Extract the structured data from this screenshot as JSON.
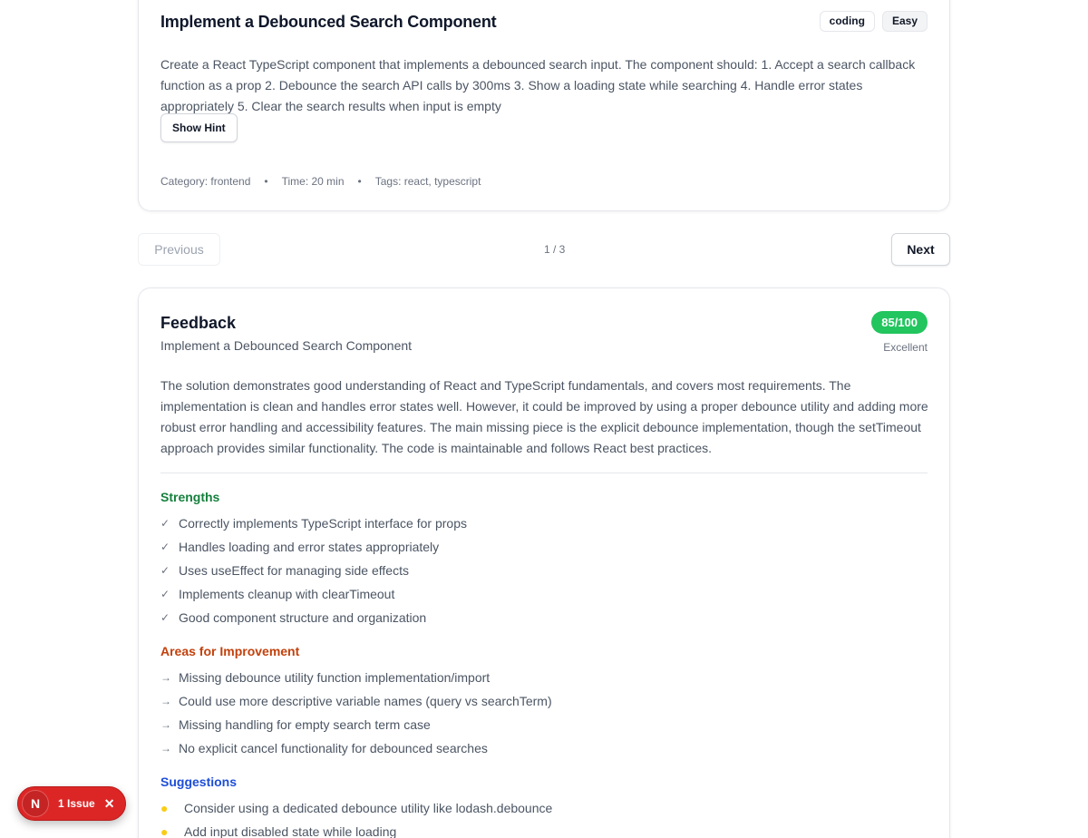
{
  "question": {
    "title": "Implement a Debounced Search Component",
    "badges": [
      "coding",
      "Easy"
    ],
    "description": "Create a React TypeScript component that implements a debounced search input. The component should: 1. Accept a search callback function as a prop 2. Debounce the search API calls by 300ms 3. Show a loading state while searching 4. Handle error states appropriately 5. Clear the search results when input is empty",
    "hint_button": "Show Hint",
    "meta": {
      "category": "Category: frontend",
      "time": "Time: 20 min",
      "tags": "Tags: react, typescript",
      "separator": "•"
    }
  },
  "pagination": {
    "previous": "Previous",
    "next": "Next",
    "position": "1 / 3"
  },
  "feedback": {
    "title": "Feedback",
    "subtitle": "Implement a Debounced Search Component",
    "score": "85/100",
    "score_label": "Excellent",
    "summary": "The solution demonstrates good understanding of React and TypeScript fundamentals, and covers most requirements. The implementation is clean and handles error states well. However, it could be improved by using a proper debounce utility and adding more robust error handling and accessibility features. The main missing piece is the explicit debounce implementation, though the setTimeout approach provides similar functionality. The code is maintainable and follows React best practices.",
    "strengths": {
      "title": "Strengths",
      "items": [
        "Correctly implements TypeScript interface for props",
        "Handles loading and error states appropriately",
        "Uses useEffect for managing side effects",
        "Implements cleanup with clearTimeout",
        "Good component structure and organization"
      ]
    },
    "improvements": {
      "title": "Areas for Improvement",
      "items": [
        "Missing debounce utility function implementation/import",
        "Could use more descriptive variable names (query vs searchTerm)",
        "Missing handling for empty search term case",
        "No explicit cancel functionality for debounced searches"
      ]
    },
    "suggestions": {
      "title": "Suggestions",
      "items": [
        "Consider using a dedicated debounce utility like lodash.debounce",
        "Add input disabled state while loading"
      ]
    }
  },
  "dev_indicator": {
    "logo": "N",
    "issues": "1 Issue",
    "close": "✕"
  },
  "colors": {
    "score_bg": "#22c55e",
    "strengths": "#15803d",
    "improvements": "#c2410c",
    "suggestions": "#1d4ed8",
    "issue_pill": "#dc2626"
  }
}
